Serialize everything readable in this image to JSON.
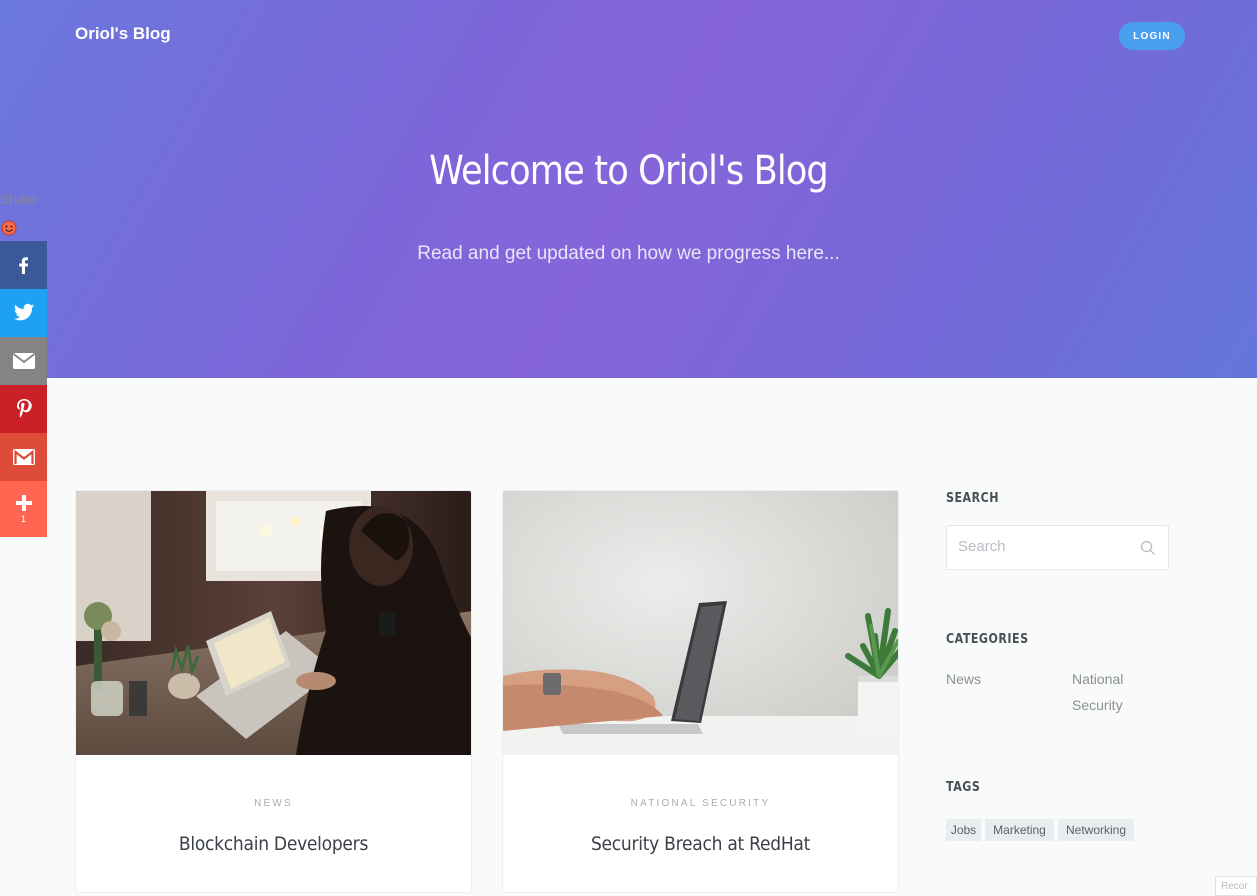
{
  "header": {
    "brand": "Oriol's Blog",
    "login_label": "LOGIN"
  },
  "hero": {
    "title": "Welcome to Oriol's Blog",
    "subtitle": "Read and get updated on how we progress here..."
  },
  "share": {
    "label": "Share",
    "buttons": [
      {
        "icon": "facebook-icon",
        "color": "#3b5998"
      },
      {
        "icon": "twitter-icon",
        "color": "#1da1f2"
      },
      {
        "icon": "email-icon",
        "color": "#848484"
      },
      {
        "icon": "pinterest-icon",
        "color": "#cb2027"
      },
      {
        "icon": "gmail-icon",
        "color": "#dd4b39"
      },
      {
        "icon": "plus-icon",
        "color": "#ff6550"
      }
    ],
    "more_count": "1"
  },
  "posts": [
    {
      "category": "NEWS",
      "title": "Blockchain Developers"
    },
    {
      "category": "NATIONAL SECURITY",
      "title": "Security Breach at RedHat"
    }
  ],
  "sidebar": {
    "search_heading": "SEARCH",
    "search_placeholder": "Search",
    "categories_heading": "CATEGORIES",
    "categories": [
      "News",
      "National Security"
    ],
    "tags_heading": "TAGS",
    "tags": [
      "Jobs",
      "Marketing",
      "Networking"
    ]
  },
  "corner_widget": "Recor"
}
